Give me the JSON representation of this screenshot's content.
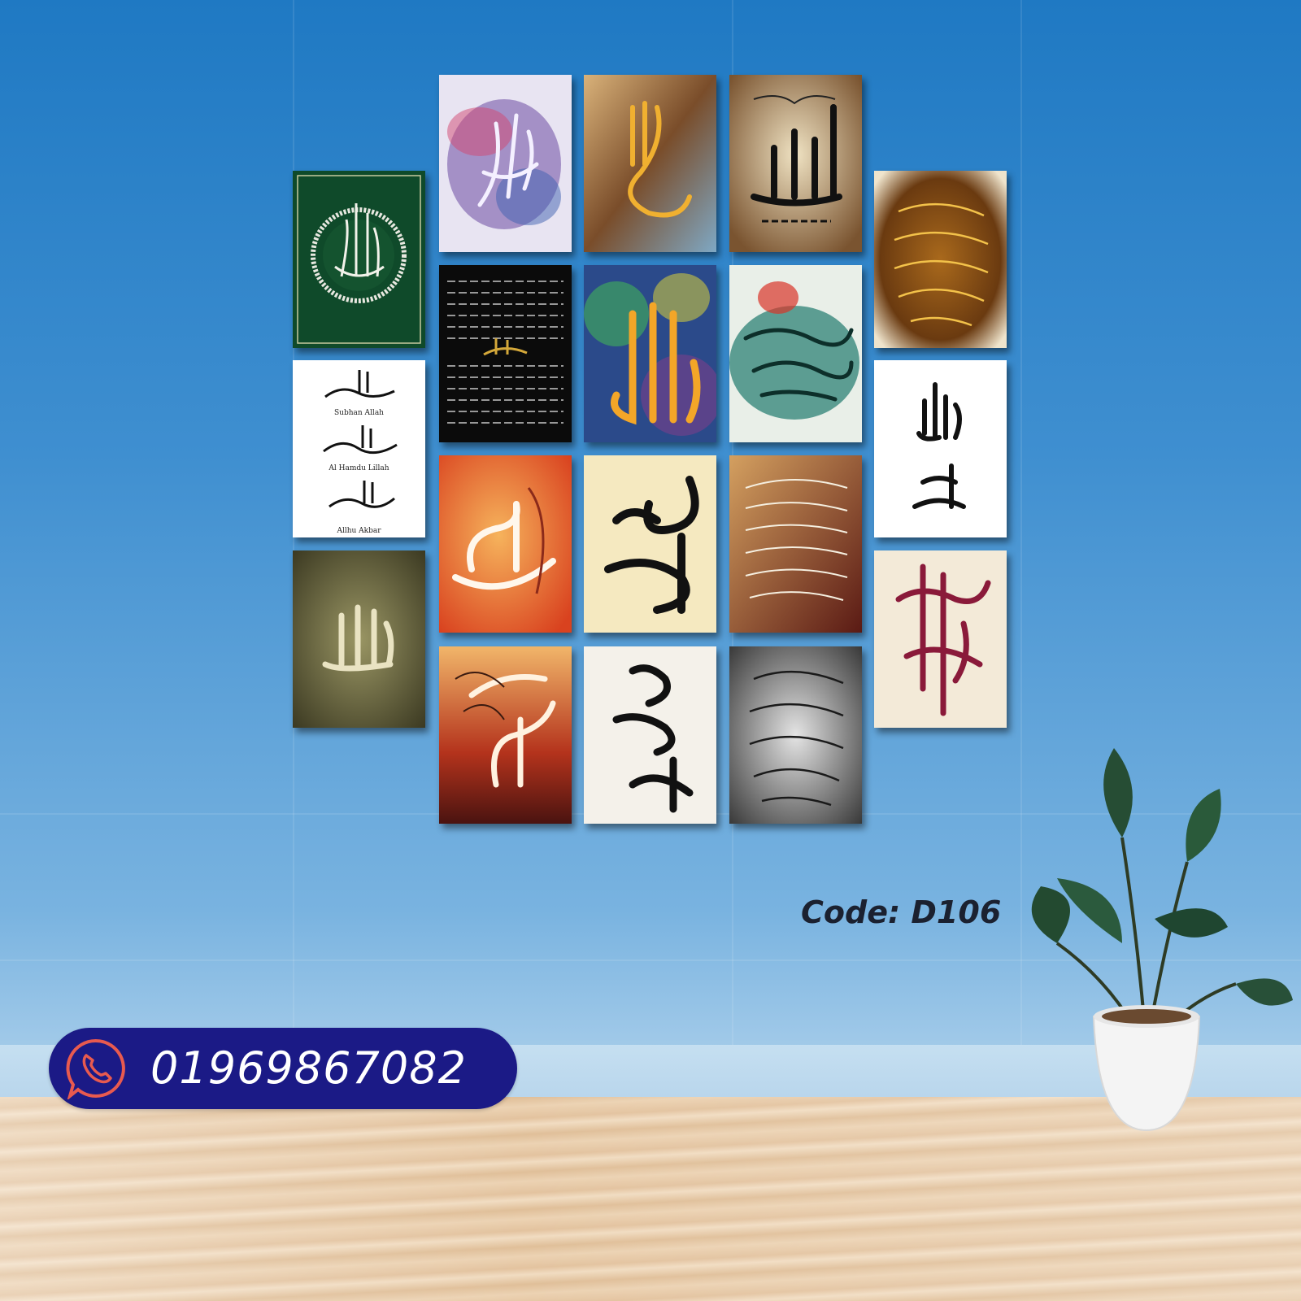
{
  "product": {
    "code_label": "Code: D106"
  },
  "contact": {
    "icon": "whatsapp-icon",
    "phone": "01969867082"
  },
  "frames": {
    "frame_white_tasbih": {
      "captions": [
        "Subhan Allah",
        "Al Hamdu Lillah",
        "Allhu Akbar"
      ]
    }
  },
  "colors": {
    "wall": "#2f86cc",
    "pill": "#1b1a86",
    "code_text": "#1b2130",
    "floor": "#e8caa7"
  }
}
